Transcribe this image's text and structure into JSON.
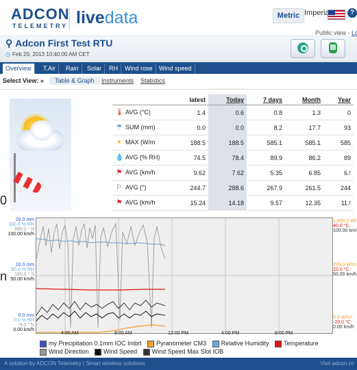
{
  "header": {
    "logo_top": "ADCON",
    "logo_bottom": "TELEMETRY",
    "product_live": "live",
    "product_data": "data",
    "unit_metric": "Metric",
    "unit_imperial": "Imperial",
    "public_view": "Public view - ",
    "public_link": "Lo"
  },
  "station": {
    "name": "Adcon First Test RTU",
    "date": "Feb 20, 2013 10:40:00 AM CET"
  },
  "tabs": [
    "Overview",
    "T.Air",
    "Rain",
    "Solar",
    "RH",
    "Wind rose",
    "Wind speed"
  ],
  "subnav": {
    "label": "Select View: »",
    "active": "Table & Graph",
    "items": [
      "Instruments",
      "Statistics"
    ]
  },
  "table": {
    "headers": [
      "latest",
      "Today",
      "7 days",
      "Month",
      "Year"
    ],
    "rows": [
      {
        "icon": "thermometer-icon",
        "name": "AVG (°C)",
        "values": [
          "1.4",
          "0.6",
          "0.8",
          "1.3",
          "0"
        ]
      },
      {
        "icon": "rain-icon",
        "name": "SUM (mm)",
        "values": [
          "0.0",
          "0.0",
          "8.2",
          "17.7",
          "93"
        ]
      },
      {
        "icon": "sun-icon",
        "name": "MAX (W/m",
        "values": [
          "188.5",
          "188.5",
          "585.1",
          "585.1",
          "585"
        ]
      },
      {
        "icon": "drop-icon",
        "name": "AVG (% RH)",
        "values": [
          "74.5",
          "78.4",
          "89.9",
          "86.2",
          "89"
        ]
      },
      {
        "icon": "windsock-icon",
        "name": "AVG (km/h",
        "values": [
          "9.62",
          "7.62",
          "5.35",
          "6.85",
          "6.!"
        ]
      },
      {
        "icon": "wind-direction-icon",
        "name": "AVG (°)",
        "values": [
          "244.7",
          "288.6",
          "267.9",
          "261.5",
          "244"
        ]
      },
      {
        "icon": "windsock-icon",
        "name": "AVG (km/h",
        "values": [
          "15.24",
          "14.18",
          "9.57",
          "12.35",
          "11.!"
        ]
      }
    ]
  },
  "chart": {
    "left_top": [
      "20.0 mm",
      "100.0 % RH",
      "360.0 ° N",
      "100.00 km/h"
    ],
    "left_mid": [
      "10.0 mm",
      "50.0 % RH",
      "180.0 ° S",
      "50.00 km/h"
    ],
    "left_bot": [
      "0.0 mm",
      "0.0 % RH",
      "0.0 ° N",
      "0.00 km/h"
    ],
    "right_top": [
      "1,400.0 W/",
      "40.0 °C",
      "100.00 km/"
    ],
    "right_mid": [
      "700.0 W/m",
      "10.0 °C",
      "50.00 km/h"
    ],
    "right_bot": [
      "0.0 W/m²",
      "-20.0 °C",
      "0.00 km/h"
    ],
    "x_labels": [
      "4:00 AM",
      "8:00 AM",
      "12:00 PM",
      "4:00 PM",
      "8:00 PM"
    ],
    "legend": [
      {
        "label": "my Precipitation 0.1mm IOC Imbrt",
        "color": "#3355cc"
      },
      {
        "label": "Pyranometer CM3",
        "color": "#f0a030"
      },
      {
        "label": "Relative Humidity",
        "color": "#6aa8d8"
      },
      {
        "label": "Temperature",
        "color": "#dd1111"
      },
      {
        "label": "Wind Direction",
        "color": "#999999"
      },
      {
        "label": "Wind Speed",
        "color": "#111111"
      },
      {
        "label": "Wind Speed Max Slot IOB",
        "color": "#333333"
      }
    ]
  },
  "footer": {
    "left": "A solution by ADCON Telemetry | Smart wireless solutions",
    "right": "Visit adcon.co"
  },
  "stray": {
    "a": "0",
    "b": "n"
  }
}
